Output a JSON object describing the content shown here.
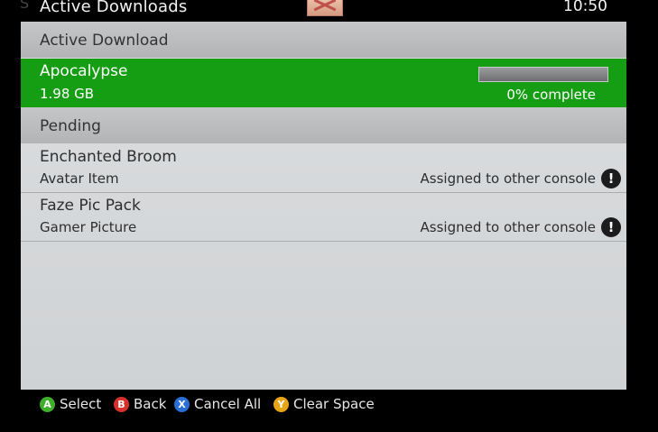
{
  "header": {
    "title": "Active Downloads",
    "time": "10:50"
  },
  "sections": {
    "active": "Active Download",
    "pending": "Pending"
  },
  "active_download": {
    "name": "Apocalypse",
    "size": "1.98 GB",
    "progress_percent": 0,
    "progress_text": "0% complete"
  },
  "pending_items": [
    {
      "name": "Enchanted Broom",
      "type": "Avatar Item",
      "status": "Assigned to other console"
    },
    {
      "name": "Faze Pic Pack",
      "type": "Gamer Picture",
      "status": "Assigned to other console"
    }
  ],
  "footer": {
    "buttons": [
      {
        "key": "A",
        "label": "Select",
        "color": "#3fae2a"
      },
      {
        "key": "B",
        "label": "Back",
        "color": "#d8312b"
      },
      {
        "key": "X",
        "label": "Cancel All",
        "color": "#2a6fd6"
      },
      {
        "key": "Y",
        "label": "Clear Space",
        "color": "#e8a317"
      }
    ]
  },
  "colors": {
    "active_row": "#159e13",
    "panel": "#d6d8da"
  }
}
